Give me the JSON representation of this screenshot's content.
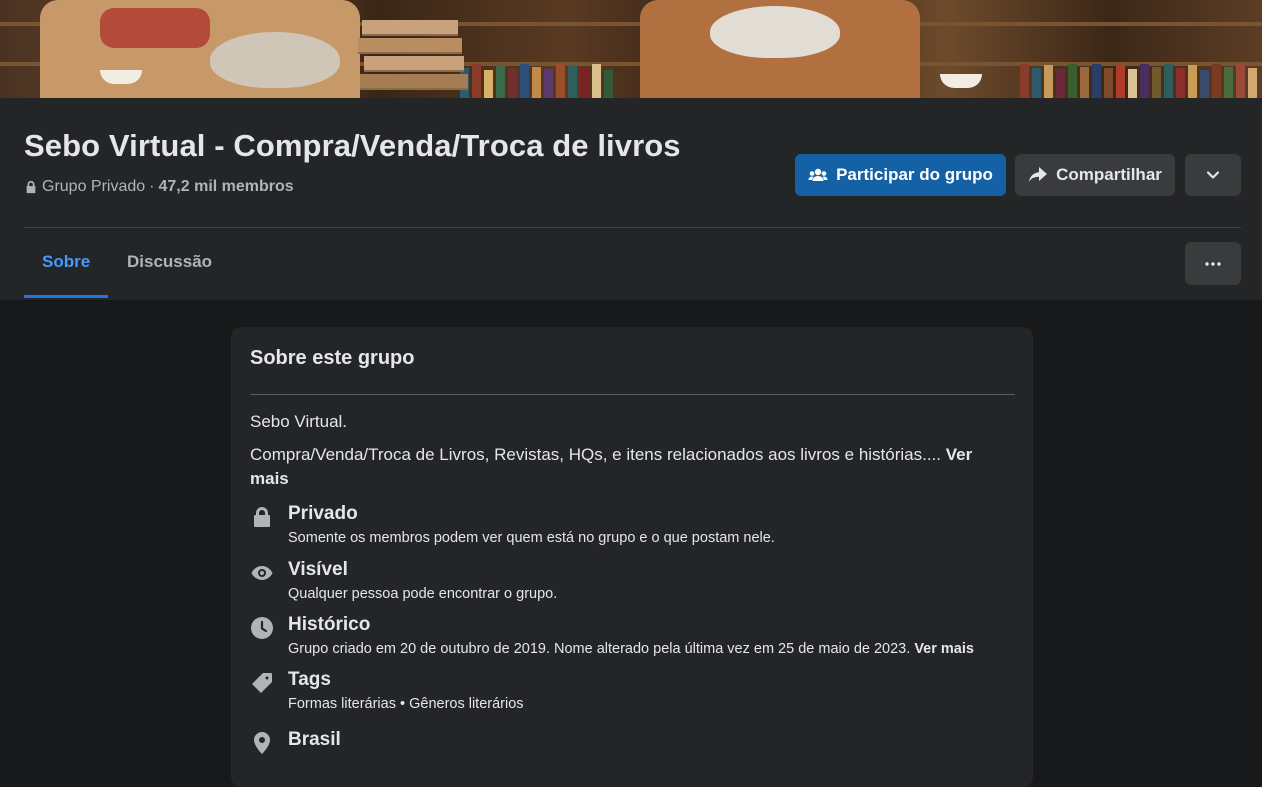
{
  "group": {
    "title": "Sebo Virtual - Compra/Venda/Troca de livros",
    "privacy": "Grupo Privado",
    "separator": "·",
    "members": "47,2 mil membros"
  },
  "actions": {
    "join_label": "Participar do grupo",
    "share_label": "Compartilhar"
  },
  "tabs": [
    {
      "label": "Sobre",
      "active": true
    },
    {
      "label": "Discussão",
      "active": false
    }
  ],
  "about": {
    "heading": "Sobre este grupo",
    "description_line1": "Sebo Virtual.",
    "description_line2": "Compra/Venda/Troca de Livros, Revistas, HQs, e itens relacionados aos livros e histórias....",
    "see_more": "Ver mais",
    "items": [
      {
        "icon": "lock-icon",
        "title": "Privado",
        "subtitle": "Somente os membros podem ver quem está no grupo e o que postam nele."
      },
      {
        "icon": "eye-icon",
        "title": "Visível",
        "subtitle": "Qualquer pessoa pode encontrar o grupo."
      },
      {
        "icon": "clock-icon",
        "title": "Histórico",
        "subtitle": "Grupo criado em 20 de outubro de 2019. Nome alterado pela última vez em 25 de maio de 2023.",
        "link": "Ver mais"
      },
      {
        "icon": "tag-icon",
        "title": "Tags",
        "subtitle": "Formas literárias • Gêneros literários"
      },
      {
        "icon": "location-pin-icon",
        "title": "Brasil"
      }
    ]
  },
  "colors": {
    "page_bg": "#18191a",
    "surface": "#242526",
    "primary_button": "#1561a6",
    "active_tab": "#4599ff",
    "text_primary": "#e4e6eb",
    "text_secondary": "#b0b3b8"
  }
}
